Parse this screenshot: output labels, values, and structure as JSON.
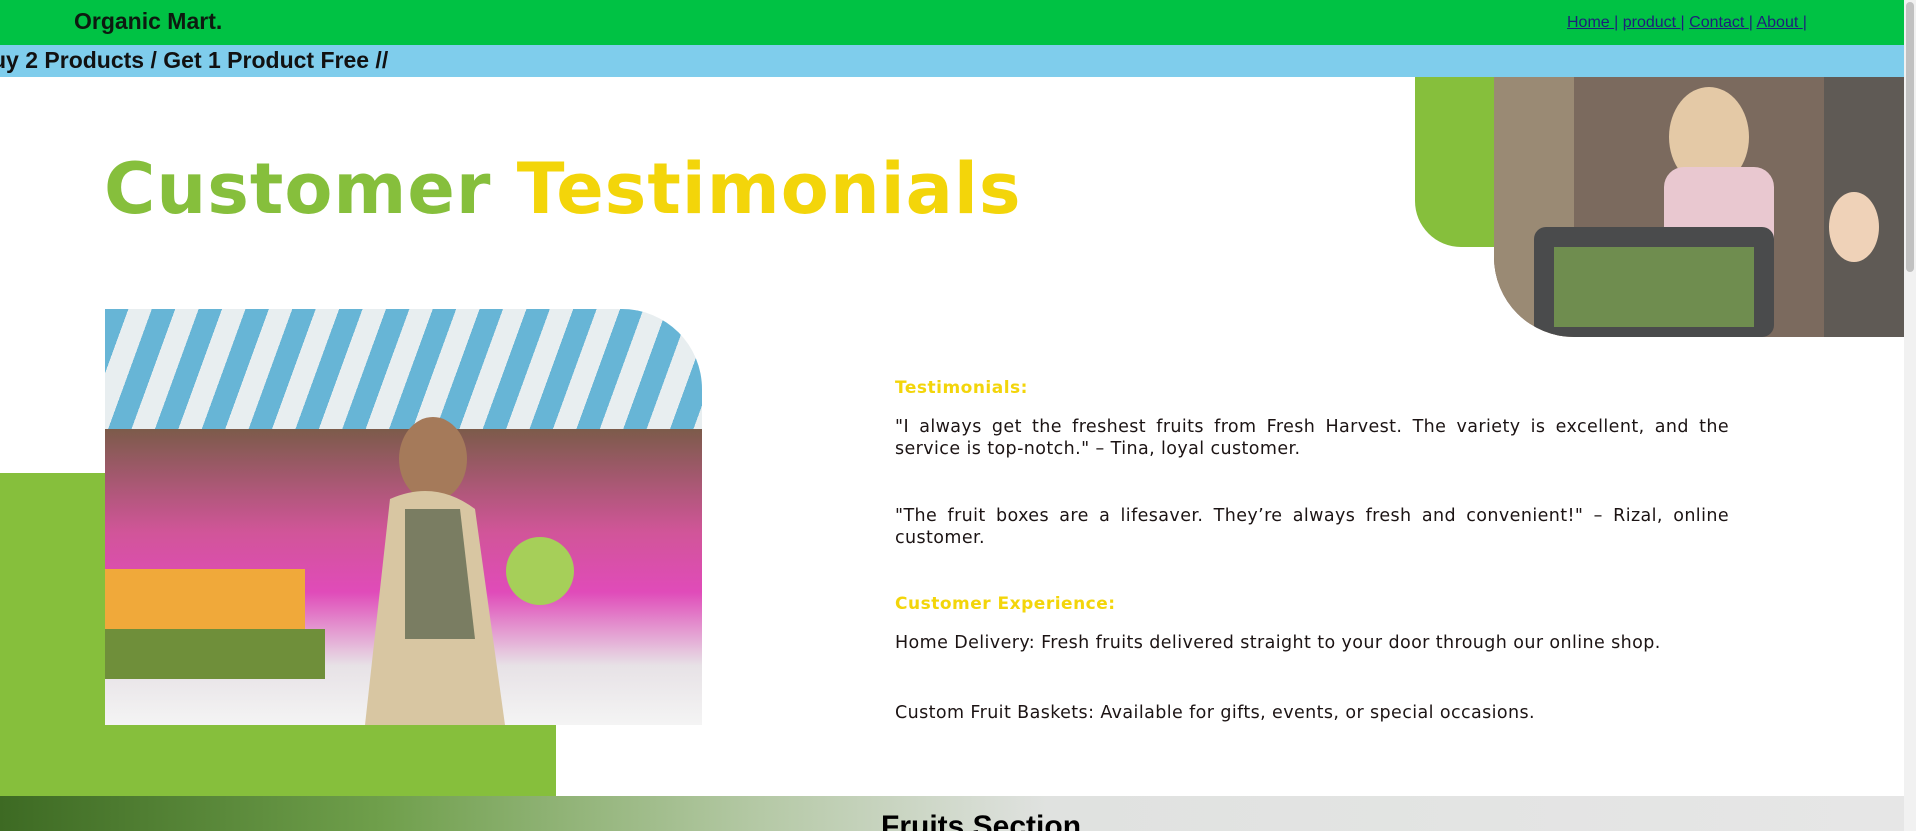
{
  "header": {
    "brand": "Organic Mart.",
    "nav": [
      {
        "label": "Home "
      },
      {
        "label": "product "
      },
      {
        "label": "Contact "
      },
      {
        "label": "About "
      }
    ],
    "separator": "|"
  },
  "promo": {
    "text": "uy 2 Products / Get 1 Product Free //"
  },
  "hero": {
    "title_part1": "Customer",
    "title_part2": "Testimonials"
  },
  "testimonials": {
    "heading": "Testimonials:",
    "quotes": [
      "\"I always get the freshest fruits from Fresh Harvest. The variety is excellent, and the service is top-notch.\" – Tina, loyal customer.",
      "\"The fruit boxes are a lifesaver. They’re always fresh and convenient!\" – Rizal, online customer."
    ]
  },
  "experience": {
    "heading": "Customer Experience:",
    "items": [
      "Home Delivery: Fresh fruits delivered straight to your door through our online shop.",
      "Custom Fruit Baskets: Available for gifts, events, or special occasions."
    ]
  },
  "fruits_section": {
    "title": "Fruits Section"
  },
  "colors": {
    "header_bg": "#00c244",
    "promo_bg": "#7fcdec",
    "accent_green": "#86bf3c",
    "accent_yellow": "#f3d50a"
  }
}
